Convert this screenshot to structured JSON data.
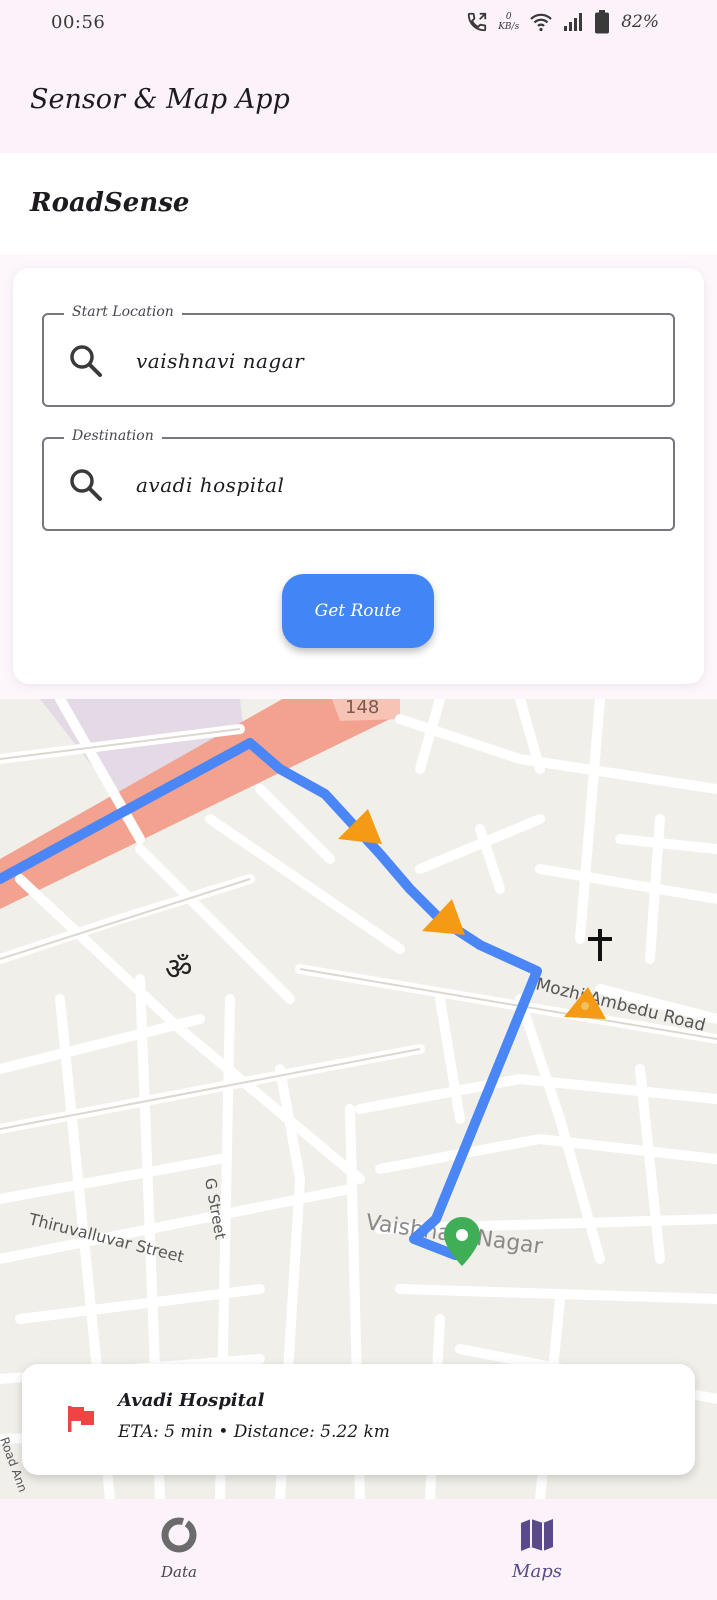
{
  "status_bar": {
    "time": "00:56",
    "net_speed_value": "0",
    "net_speed_unit": "KB/s",
    "battery": "82%"
  },
  "app_bar": {
    "title": "Sensor & Map App"
  },
  "section": {
    "title": "RoadSense"
  },
  "form": {
    "start": {
      "label": "Start Location",
      "value": "vaishnavi nagar"
    },
    "destination": {
      "label": "Destination",
      "value": "avadi hospital"
    },
    "get_route_label": "Get Route"
  },
  "map": {
    "labels": {
      "thiruvalluvar": "Thiruvalluvar Street",
      "g_street": "G Street",
      "vaishnavi": "Vaishnavi Nagar",
      "road": "Mozhi Ambedu Road",
      "road_ann": "Road Ann",
      "shield": "148"
    },
    "route_color": "#4a86f5",
    "warning_color": "#f59a14",
    "marker_color": "#3fae57"
  },
  "info_card": {
    "title": "Avadi Hospital",
    "subtitle": "ETA: 5 min • Distance: 5.22 km"
  },
  "bottom_nav": {
    "items": [
      {
        "label": "Data",
        "icon": "donut-icon"
      },
      {
        "label": "Maps",
        "icon": "map-icon"
      }
    ]
  }
}
